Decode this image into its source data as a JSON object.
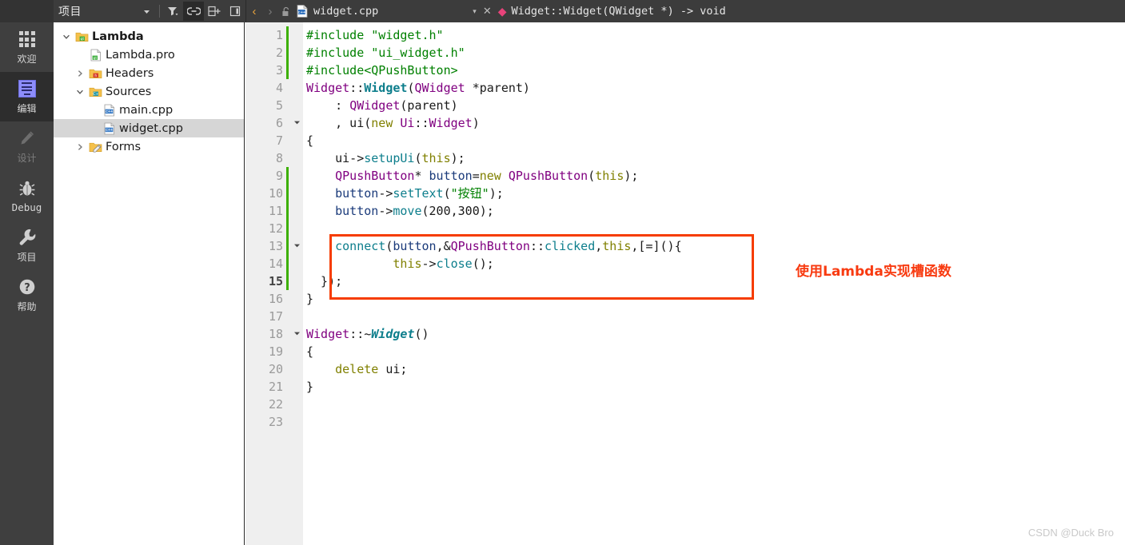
{
  "window": {
    "project_panel_title": "项目",
    "watermark": "CSDN @Duck Bro"
  },
  "panel_toolbar": [
    {
      "name": "panel-dropdown",
      "icon": "chevron-down-icon",
      "glyph": "▾",
      "active": false
    },
    {
      "name": "filter",
      "icon": "filter-icon",
      "glyph": "",
      "active": false
    },
    {
      "name": "link-with-editor",
      "icon": "link-icon",
      "glyph": "",
      "active": true
    },
    {
      "name": "add-split",
      "icon": "split-add-icon",
      "glyph": "",
      "active": false
    },
    {
      "name": "close-panel",
      "icon": "close-panel-icon",
      "glyph": "",
      "active": false
    }
  ],
  "modebar": [
    {
      "label": "欢迎",
      "icon": "grid-icon",
      "state": "normal"
    },
    {
      "label": "编辑",
      "icon": "document-lines-icon",
      "state": "selected"
    },
    {
      "label": "设计",
      "icon": "pencil-icon",
      "state": "disabled"
    },
    {
      "label": "Debug",
      "icon": "bug-icon",
      "state": "normal"
    },
    {
      "label": "项目",
      "icon": "wrench-icon",
      "state": "normal"
    },
    {
      "label": "帮助",
      "icon": "question-circle-icon",
      "state": "normal"
    }
  ],
  "project_tree": [
    {
      "label": "Lambda",
      "indent": 0,
      "twisty": "open",
      "icon": "qt-project-folder-icon",
      "bold": true,
      "selected": false
    },
    {
      "label": "Lambda.pro",
      "indent": 1,
      "twisty": "none",
      "icon": "qt-pro-file-icon",
      "bold": false,
      "selected": false
    },
    {
      "label": "Headers",
      "indent": 1,
      "twisty": "closed",
      "icon": "headers-folder-icon",
      "bold": false,
      "selected": false
    },
    {
      "label": "Sources",
      "indent": 1,
      "twisty": "open",
      "icon": "sources-folder-icon",
      "bold": false,
      "selected": false
    },
    {
      "label": "main.cpp",
      "indent": 2,
      "twisty": "none",
      "icon": "cpp-file-icon",
      "bold": false,
      "selected": false
    },
    {
      "label": "widget.cpp",
      "indent": 2,
      "twisty": "none",
      "icon": "cpp-file-icon",
      "bold": false,
      "selected": true
    },
    {
      "label": "Forms",
      "indent": 1,
      "twisty": "closed",
      "icon": "forms-folder-icon",
      "bold": false,
      "selected": false
    }
  ],
  "editor_tabbar": {
    "back_arrow": "‹",
    "forward_arrow": "›",
    "lock_icon": "unlock-icon",
    "file_icon": "cpp-file-icon",
    "filename": "widget.cpp",
    "dropdown_glyph": "▾",
    "close_glyph": "✕",
    "symbol_marker": "◆",
    "symbol": "Widget::Widget(QWidget *) -> void"
  },
  "annotation": {
    "text": "使用Lambda实现槽函数",
    "box_color": "#f63c00",
    "text_color": "#f83a10"
  },
  "code": {
    "current_line": 15,
    "lines": [
      {
        "n": 1,
        "changed": true,
        "fold": false,
        "tokens": [
          {
            "t": "#include ",
            "c": "c-pre"
          },
          {
            "t": "\"widget.h\"",
            "c": "c-str"
          }
        ]
      },
      {
        "n": 2,
        "changed": true,
        "fold": false,
        "tokens": [
          {
            "t": "#include ",
            "c": "c-pre"
          },
          {
            "t": "\"ui_widget.h\"",
            "c": "c-str"
          }
        ]
      },
      {
        "n": 3,
        "changed": true,
        "fold": false,
        "tokens": [
          {
            "t": "#include",
            "c": "c-pre"
          },
          {
            "t": "<QPushButton>",
            "c": "c-str"
          }
        ]
      },
      {
        "n": 4,
        "changed": false,
        "fold": false,
        "tokens": [
          {
            "t": "Widget",
            "c": "c-type"
          },
          {
            "t": "::",
            "c": "c-plain"
          },
          {
            "t": "Widget",
            "c": "c-fnb"
          },
          {
            "t": "(",
            "c": "c-plain"
          },
          {
            "t": "QWidget",
            "c": "c-type"
          },
          {
            "t": " *parent)",
            "c": "c-plain"
          }
        ]
      },
      {
        "n": 5,
        "changed": false,
        "fold": false,
        "tokens": [
          {
            "t": "    : ",
            "c": "c-plain"
          },
          {
            "t": "QWidget",
            "c": "c-type"
          },
          {
            "t": "(parent)",
            "c": "c-plain"
          }
        ]
      },
      {
        "n": 6,
        "changed": false,
        "fold": true,
        "tokens": [
          {
            "t": "    , ui(",
            "c": "c-plain"
          },
          {
            "t": "new",
            "c": "c-kw"
          },
          {
            "t": " ",
            "c": "c-plain"
          },
          {
            "t": "Ui",
            "c": "c-type"
          },
          {
            "t": "::",
            "c": "c-plain"
          },
          {
            "t": "Widget",
            "c": "c-type"
          },
          {
            "t": ")",
            "c": "c-plain"
          }
        ]
      },
      {
        "n": 7,
        "changed": false,
        "fold": false,
        "tokens": [
          {
            "t": "{",
            "c": "c-plain"
          }
        ]
      },
      {
        "n": 8,
        "changed": false,
        "fold": false,
        "tokens": [
          {
            "t": "    ui->",
            "c": "c-plain"
          },
          {
            "t": "setupUi",
            "c": "c-fn"
          },
          {
            "t": "(",
            "c": "c-plain"
          },
          {
            "t": "this",
            "c": "c-kw"
          },
          {
            "t": ");",
            "c": "c-plain"
          }
        ]
      },
      {
        "n": 9,
        "changed": true,
        "fold": false,
        "tokens": [
          {
            "t": "    ",
            "c": "c-plain"
          },
          {
            "t": "QPushButton",
            "c": "c-type"
          },
          {
            "t": "* ",
            "c": "c-plain"
          },
          {
            "t": "button",
            "c": "c-var"
          },
          {
            "t": "=",
            "c": "c-plain"
          },
          {
            "t": "new",
            "c": "c-kw"
          },
          {
            "t": " ",
            "c": "c-plain"
          },
          {
            "t": "QPushButton",
            "c": "c-type"
          },
          {
            "t": "(",
            "c": "c-plain"
          },
          {
            "t": "this",
            "c": "c-kw"
          },
          {
            "t": ");",
            "c": "c-plain"
          }
        ]
      },
      {
        "n": 10,
        "changed": true,
        "fold": false,
        "tokens": [
          {
            "t": "    ",
            "c": "c-plain"
          },
          {
            "t": "button",
            "c": "c-var"
          },
          {
            "t": "->",
            "c": "c-plain"
          },
          {
            "t": "setText",
            "c": "c-fn"
          },
          {
            "t": "(",
            "c": "c-plain"
          },
          {
            "t": "\"按钮\"",
            "c": "c-str"
          },
          {
            "t": ");",
            "c": "c-plain"
          }
        ]
      },
      {
        "n": 11,
        "changed": true,
        "fold": false,
        "tokens": [
          {
            "t": "    ",
            "c": "c-plain"
          },
          {
            "t": "button",
            "c": "c-var"
          },
          {
            "t": "->",
            "c": "c-plain"
          },
          {
            "t": "move",
            "c": "c-fn"
          },
          {
            "t": "(",
            "c": "c-plain"
          },
          {
            "t": "200",
            "c": "c-num"
          },
          {
            "t": ",",
            "c": "c-plain"
          },
          {
            "t": "300",
            "c": "c-num"
          },
          {
            "t": ");",
            "c": "c-plain"
          }
        ]
      },
      {
        "n": 12,
        "changed": true,
        "fold": false,
        "tokens": [
          {
            "t": "",
            "c": "c-plain"
          }
        ]
      },
      {
        "n": 13,
        "changed": true,
        "fold": true,
        "tokens": [
          {
            "t": "    ",
            "c": "c-plain"
          },
          {
            "t": "connect",
            "c": "c-fn"
          },
          {
            "t": "(",
            "c": "c-plain"
          },
          {
            "t": "button",
            "c": "c-var"
          },
          {
            "t": ",&",
            "c": "c-plain"
          },
          {
            "t": "QPushButton",
            "c": "c-type"
          },
          {
            "t": "::",
            "c": "c-plain"
          },
          {
            "t": "clicked",
            "c": "c-fn"
          },
          {
            "t": ",",
            "c": "c-plain"
          },
          {
            "t": "this",
            "c": "c-kw"
          },
          {
            "t": ",[=](){",
            "c": "c-plain"
          }
        ]
      },
      {
        "n": 14,
        "changed": true,
        "fold": false,
        "tokens": [
          {
            "t": "            ",
            "c": "c-plain"
          },
          {
            "t": "this",
            "c": "c-kw"
          },
          {
            "t": "->",
            "c": "c-plain"
          },
          {
            "t": "close",
            "c": "c-fn"
          },
          {
            "t": "();",
            "c": "c-plain"
          }
        ]
      },
      {
        "n": 15,
        "changed": true,
        "fold": false,
        "tokens": [
          {
            "t": "  });",
            "c": "c-plain"
          }
        ]
      },
      {
        "n": 16,
        "changed": false,
        "fold": false,
        "tokens": [
          {
            "t": "}",
            "c": "c-plain"
          }
        ]
      },
      {
        "n": 17,
        "changed": false,
        "fold": false,
        "tokens": [
          {
            "t": "",
            "c": "c-plain"
          }
        ]
      },
      {
        "n": 18,
        "changed": false,
        "fold": true,
        "tokens": [
          {
            "t": "Widget",
            "c": "c-type"
          },
          {
            "t": "::~",
            "c": "c-plain"
          },
          {
            "t": "Widget",
            "c": "c-fnbi"
          },
          {
            "t": "()",
            "c": "c-plain"
          }
        ]
      },
      {
        "n": 19,
        "changed": false,
        "fold": false,
        "tokens": [
          {
            "t": "{",
            "c": "c-plain"
          }
        ]
      },
      {
        "n": 20,
        "changed": false,
        "fold": false,
        "tokens": [
          {
            "t": "    ",
            "c": "c-plain"
          },
          {
            "t": "delete",
            "c": "c-kw"
          },
          {
            "t": " ui;",
            "c": "c-plain"
          }
        ]
      },
      {
        "n": 21,
        "changed": false,
        "fold": false,
        "tokens": [
          {
            "t": "}",
            "c": "c-plain"
          }
        ]
      },
      {
        "n": 22,
        "changed": false,
        "fold": false,
        "tokens": [
          {
            "t": "",
            "c": "c-plain"
          }
        ]
      },
      {
        "n": 23,
        "changed": false,
        "fold": false,
        "tokens": [
          {
            "t": "",
            "c": "c-plain"
          }
        ]
      }
    ]
  }
}
